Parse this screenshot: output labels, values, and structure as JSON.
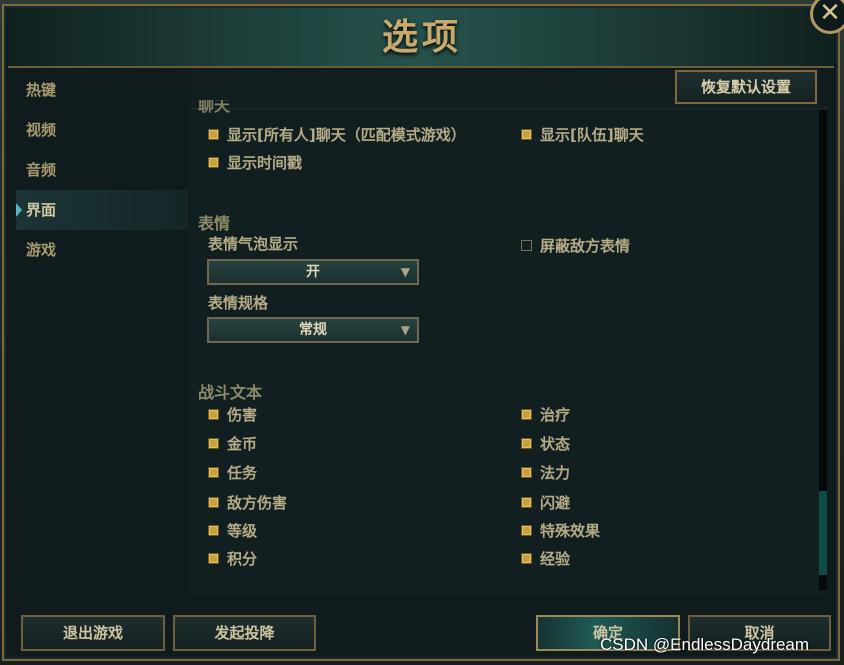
{
  "window": {
    "title": "选项",
    "close_label": "✕"
  },
  "sidebar": {
    "items": [
      {
        "label": "热键"
      },
      {
        "label": "视频"
      },
      {
        "label": "音频"
      },
      {
        "label": "界面"
      },
      {
        "label": "游戏"
      }
    ],
    "active_index": 3
  },
  "panel": {
    "reset_label": "恢复默认设置",
    "chat": {
      "title_clipped": "聊天",
      "options": [
        {
          "label": "显示[所有人]聊天（匹配模式游戏）",
          "checked": true
        },
        {
          "label": "显示[队伍]聊天",
          "checked": true
        },
        {
          "label": "显示时间戳",
          "checked": true
        }
      ]
    },
    "emotes": {
      "title": "表情",
      "bubble_label": "表情气泡显示",
      "bubble_value": "开",
      "scale_label": "表情规格",
      "scale_value": "常规",
      "block_enemy": {
        "label": "屏蔽敌方表情",
        "checked": false
      }
    },
    "combat_text": {
      "title": "战斗文本",
      "left": [
        {
          "label": "伤害",
          "checked": true
        },
        {
          "label": "金币",
          "checked": true
        },
        {
          "label": "任务",
          "checked": true
        },
        {
          "label": "敌方伤害",
          "checked": true
        },
        {
          "label": "等级",
          "checked": true
        },
        {
          "label": "积分",
          "checked": true
        }
      ],
      "right": [
        {
          "label": "治疗",
          "checked": true
        },
        {
          "label": "状态",
          "checked": true
        },
        {
          "label": "法力",
          "checked": true
        },
        {
          "label": "闪避",
          "checked": true
        },
        {
          "label": "特殊效果",
          "checked": true
        },
        {
          "label": "经验",
          "checked": true
        }
      ]
    }
  },
  "footer": {
    "quit_label": "退出游戏",
    "surrender_label": "发起投降",
    "confirm_label": "确定",
    "cancel_label": "取消"
  },
  "watermark": "CSDN @EndlessDaydream",
  "colors": {
    "gold": "#c8aa6e",
    "checkbox_gold": "#c9a03a",
    "teal_accent": "#56b7c4"
  }
}
